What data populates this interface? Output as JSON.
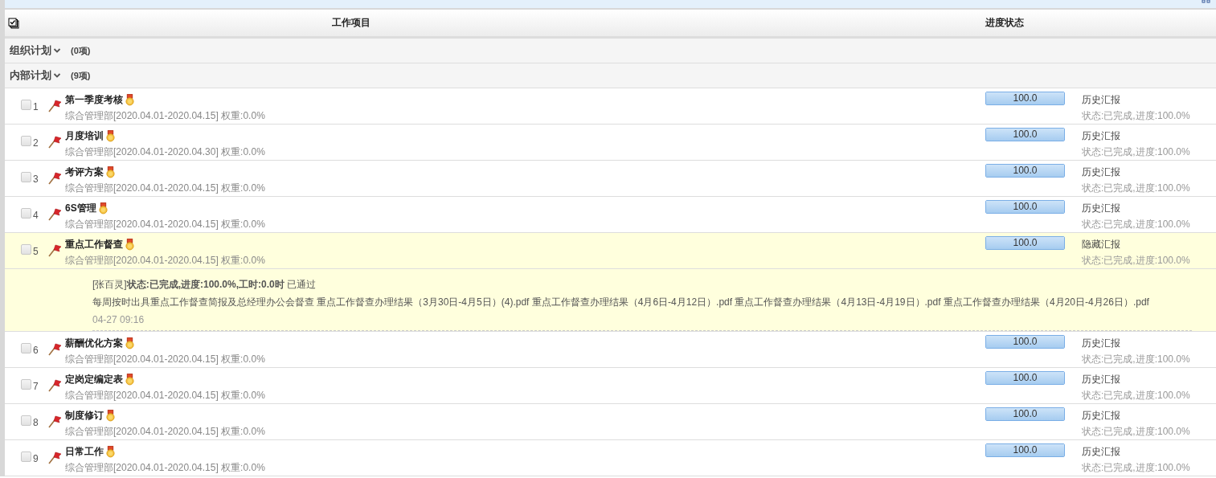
{
  "table": {
    "columns": [
      "工作项目",
      "进度状态"
    ]
  },
  "groups": [
    {
      "name": "组织计划",
      "count": "(0项)",
      "expanded": true
    },
    {
      "name": "内部计划",
      "count": "(9项)",
      "expanded": true,
      "items": [
        {
          "number": "1",
          "title": "第一季度考核",
          "info": "综合管理部[2020.04.01-2020.04.15] 权重:0.0%",
          "checked": false,
          "level": 1.0,
          "progress": "100.0",
          "report": "历史汇报",
          "status": "状态:已完成,进度:100.0%",
          "expanded": false
        },
        {
          "number": "2",
          "title": "月度培训",
          "info": "综合管理部[2020.04.01-2020.04.30] 权重:0.0%",
          "checked": false,
          "level": 1.0,
          "progress": "100.0",
          "report": "历史汇报",
          "status": "状态:已完成,进度:100.0%",
          "expanded": false
        },
        {
          "number": "3",
          "title": "考评方案",
          "info": "综合管理部[2020.04.01-2020.04.15] 权重:0.0%",
          "checked": false,
          "level": 1.0,
          "progress": "100.0",
          "report": "历史汇报",
          "status": "状态:已完成,进度:100.0%",
          "expanded": false
        },
        {
          "number": "4",
          "title": "6S管理",
          "info": "综合管理部[2020.04.01-2020.04.15] 权重:0.0%",
          "checked": false,
          "level": 1.0,
          "progress": "100.0",
          "report": "历史汇报",
          "status": "状态:已完成,进度:100.0%",
          "expanded": false
        },
        {
          "number": "5",
          "title": "重点工作督查",
          "info": "综合管理部[2020.04.01-2020.04.15] 权重:0.0%",
          "checked": false,
          "level": 1.0,
          "progress": "100.0",
          "report": "隐藏汇报",
          "status": "状态:已完成,进度:100.0%",
          "expanded": true,
          "detail": {
            "summary": "[张百灵]**状态:已完成,进度:100.0%,工时:0.0时** 已通过",
            "description": "每周按时出具重点工作督查简报及总经理办公会督查",
            "files": [
              "重点工作督查办理结果（3月30日-4月5日）(4).pdf",
              "重点工作督查办理结果（4月6日-4月12日）.pdf",
              "重点工作督查办理结果（4月13日-4月19日）.pdf",
              "重点工作督查办理结果（4月20日-4月26日）.pdf"
            ],
            "time": "04-27 09:16"
          }
        },
        {
          "number": "6",
          "title": "薪酬优化方案",
          "info": "综合管理部[2020.04.01-2020.04.15] 权重:0.0%",
          "checked": false,
          "level": 1.0,
          "progress": "100.0",
          "report": "历史汇报",
          "status": "状态:已完成,进度:100.0%",
          "expanded": false
        },
        {
          "number": "7",
          "title": "定岗定编定表",
          "info": "综合管理部[2020.04.01-2020.04.15] 权重:0.0%",
          "checked": false,
          "level": 1.0,
          "progress": "100.0",
          "report": "历史汇报",
          "status": "状态:已完成,进度:100.0%",
          "expanded": false
        },
        {
          "number": "8",
          "title": "制度修订",
          "info": "综合管理部[2020.04.01-2020.04.15] 权重:0.0%",
          "checked": false,
          "level": 1.0,
          "progress": "100.0",
          "report": "历史汇报",
          "status": "状态:已完成,进度:100.0%",
          "expanded": false
        },
        {
          "number": "9",
          "title": "日常工作",
          "info": "综合管理部[2020.04.01-2020.04.15] 权重:0.0%",
          "checked": false,
          "level": 1.0,
          "progress": "100.0",
          "report": "历史汇报",
          "status": "状态:已完成,进度:100.0%",
          "expanded": false
        }
      ]
    }
  ]
}
